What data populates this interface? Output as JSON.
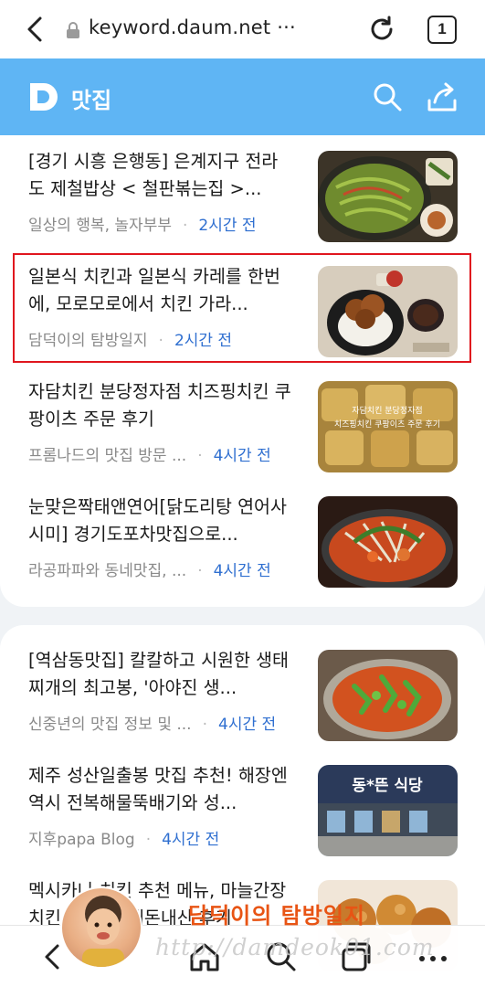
{
  "browser": {
    "url": "keyword.daum.net ···",
    "tab_count": "1"
  },
  "header": {
    "logo_letter": "D",
    "title": "맛집"
  },
  "articles": [
    {
      "title": "[경기 시흥 은행동] 은계지구 전라도 제철밥상 < 철판볶는집 >...",
      "source": "일상의 행복, 놀자부부",
      "time": "2시간 전",
      "thumb": "stir-fry-platter"
    },
    {
      "title": "일본식 치킨과 일본식 카레를 한번에, 모로모로에서 치킨 가라...",
      "source": "담덕이의 탐방일지",
      "time": "2시간 전",
      "thumb": "karaage-rice"
    },
    {
      "title": "자담치킨 분당정자점 치즈핑치킨 쿠팡이츠 주문 후기",
      "source": "프롬나드의 맛집 방문 ...",
      "time": "4시간 전",
      "thumb": "cheese-chicken"
    },
    {
      "title": "눈맞은짝태앤연어[닭도리탕 연어사시미] 경기도포차맛집으로...",
      "source": "라공파파와 동네맛집, ...",
      "time": "4시간 전",
      "thumb": "dakdoritang"
    },
    {
      "title": "[역삼동맛집] 칼칼하고 시원한 생태찌개의 최고봉, '아야진 생...",
      "source": "신중년의 맛집 정보 및 ...",
      "time": "4시간 전",
      "thumb": "saengtae-jjigae"
    },
    {
      "title": "제주 성산일출봉 맛집 추천! 해장엔 역시 전복해물뚝배기와 성...",
      "source": "지후papa Blog",
      "time": "4시간 전",
      "thumb": "restaurant-front"
    },
    {
      "title": "멕시카나 치킨 추천 메뉴, 마늘간장 치킨 ... 치킨 내돈내산 후기",
      "source": "",
      "time": "",
      "thumb": "fried-chicken"
    }
  ],
  "thumb_texts": {
    "cheese_chicken_line1": "자담치킨 분당정자점",
    "cheese_chicken_line2": "치즈핑치킨 쿠팡이츠 주문 후기",
    "restaurant_sign": "동*뜬 식당"
  },
  "watermark": {
    "title": "담덕이의 탐방일지",
    "url": "http://damdeok01.com"
  },
  "colors": {
    "header_bg": "#5fb5f4",
    "time_blue": "#2f6fd0",
    "highlight_red": "#e0161e",
    "watermark_orange": "#e85414"
  },
  "icons": {
    "browser": [
      "back-arrow-icon",
      "lock-icon",
      "reload-icon",
      "tabs-icon"
    ],
    "header": [
      "search-icon",
      "share-icon"
    ],
    "bottom_nav": [
      "back-icon",
      "home-icon",
      "search-icon",
      "tabs-icon",
      "more-icon"
    ]
  }
}
